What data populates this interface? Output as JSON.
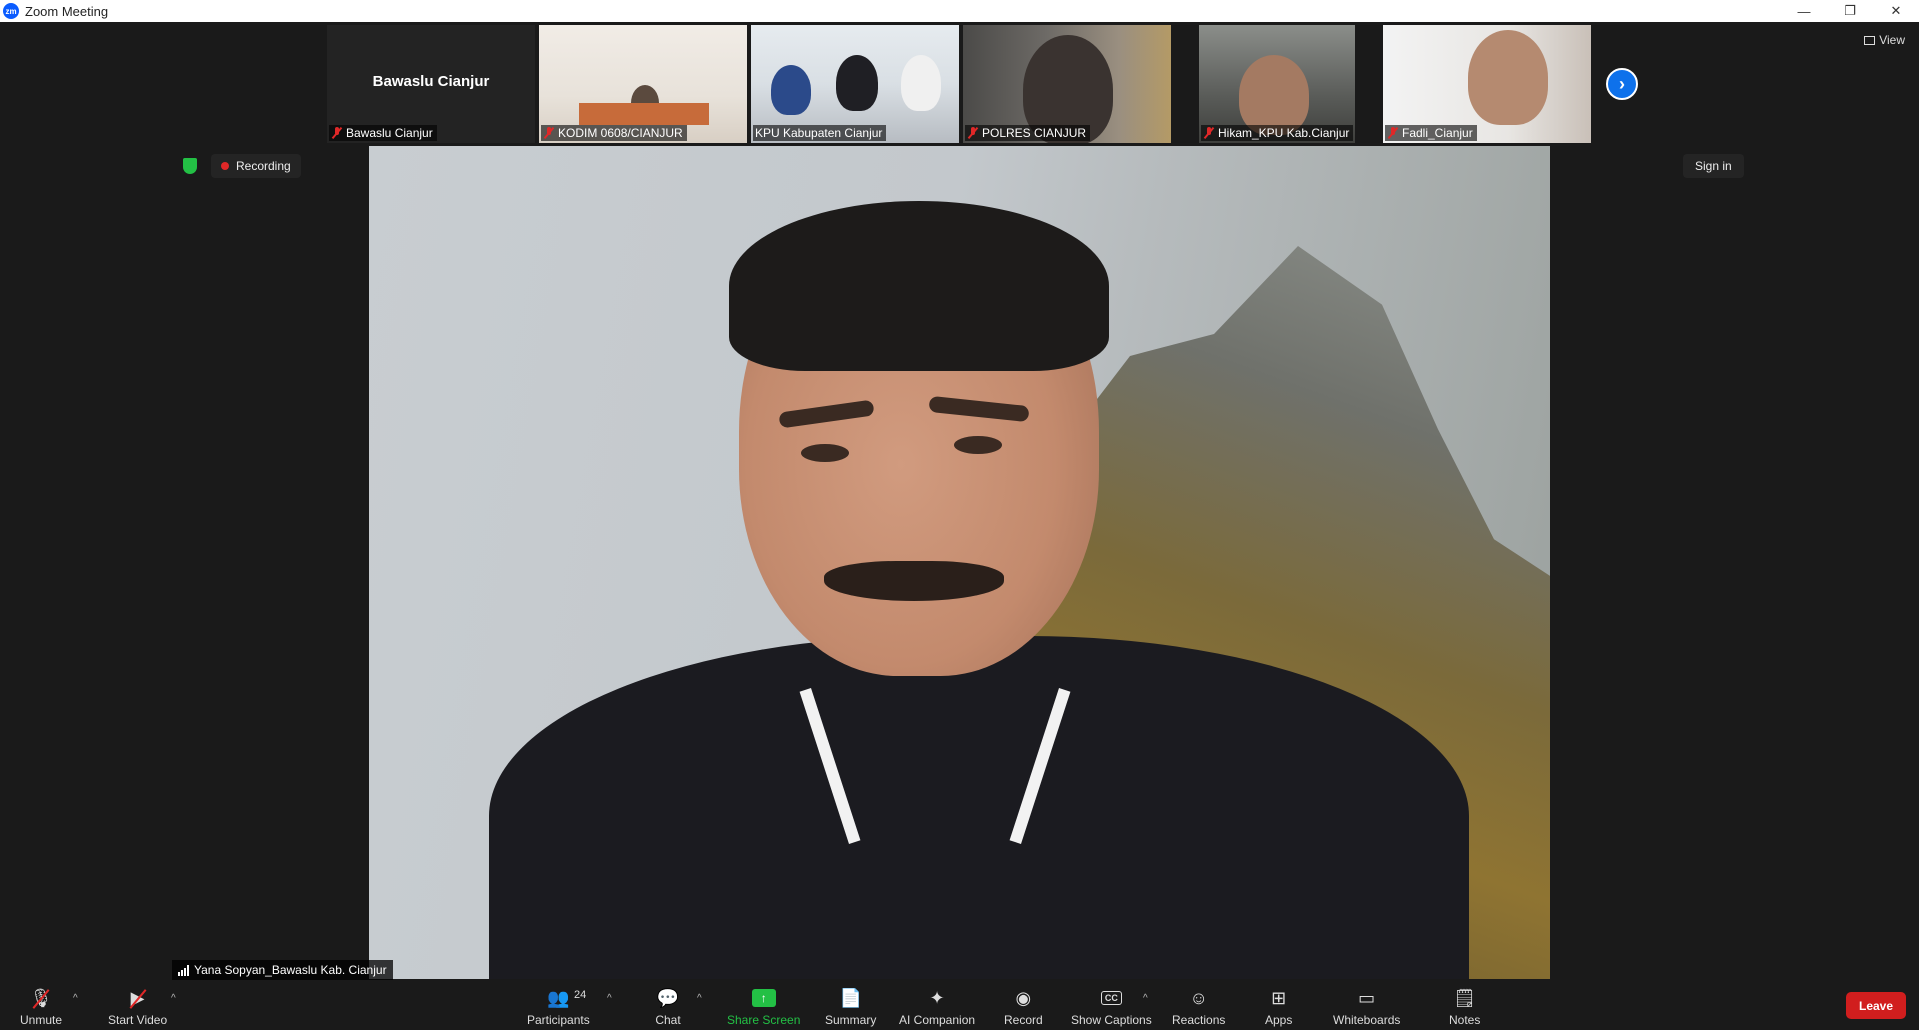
{
  "window": {
    "logo_text": "zm",
    "title": "Zoom Meeting",
    "controls": {
      "minimize": "—",
      "restore": "❐",
      "close": "✕"
    }
  },
  "thumbnails": [
    {
      "name": "Bawaslu Cianjur",
      "video_off": true,
      "display_name": "Bawaslu Cianjur",
      "muted": true
    },
    {
      "name": "KODIM 0608/CIANJUR",
      "muted": true
    },
    {
      "name": "KPU Kabupaten Cianjur",
      "muted": false
    },
    {
      "name": "POLRES CIANJUR",
      "muted": true
    },
    {
      "name": "Hikam_KPU Kab.Cianjur",
      "muted": true
    },
    {
      "name": "Fadli_Cianjur",
      "muted": true
    }
  ],
  "header": {
    "view_label": "View",
    "recording_label": "Recording",
    "sign_in_label": "Sign in",
    "next_icon": "›"
  },
  "speaker": {
    "name": "Yana Sopyan_Bawaslu Kab. Cianjur"
  },
  "toolbar": {
    "unmute": "Unmute",
    "start_video": "Start Video",
    "participants": "Participants",
    "participant_count": "24",
    "chat": "Chat",
    "share_screen": "Share Screen",
    "summary": "Summary",
    "ai_companion": "AI Companion",
    "record": "Record",
    "show_captions": "Show Captions",
    "captions_icon_text": "CC",
    "reactions": "Reactions",
    "apps": "Apps",
    "whiteboards": "Whiteboards",
    "notes": "Notes",
    "leave": "Leave"
  },
  "colors": {
    "accent": "#0e71eb",
    "share_green": "#23c045",
    "leave_red": "#d11e1e",
    "recording_red": "#e02828"
  }
}
